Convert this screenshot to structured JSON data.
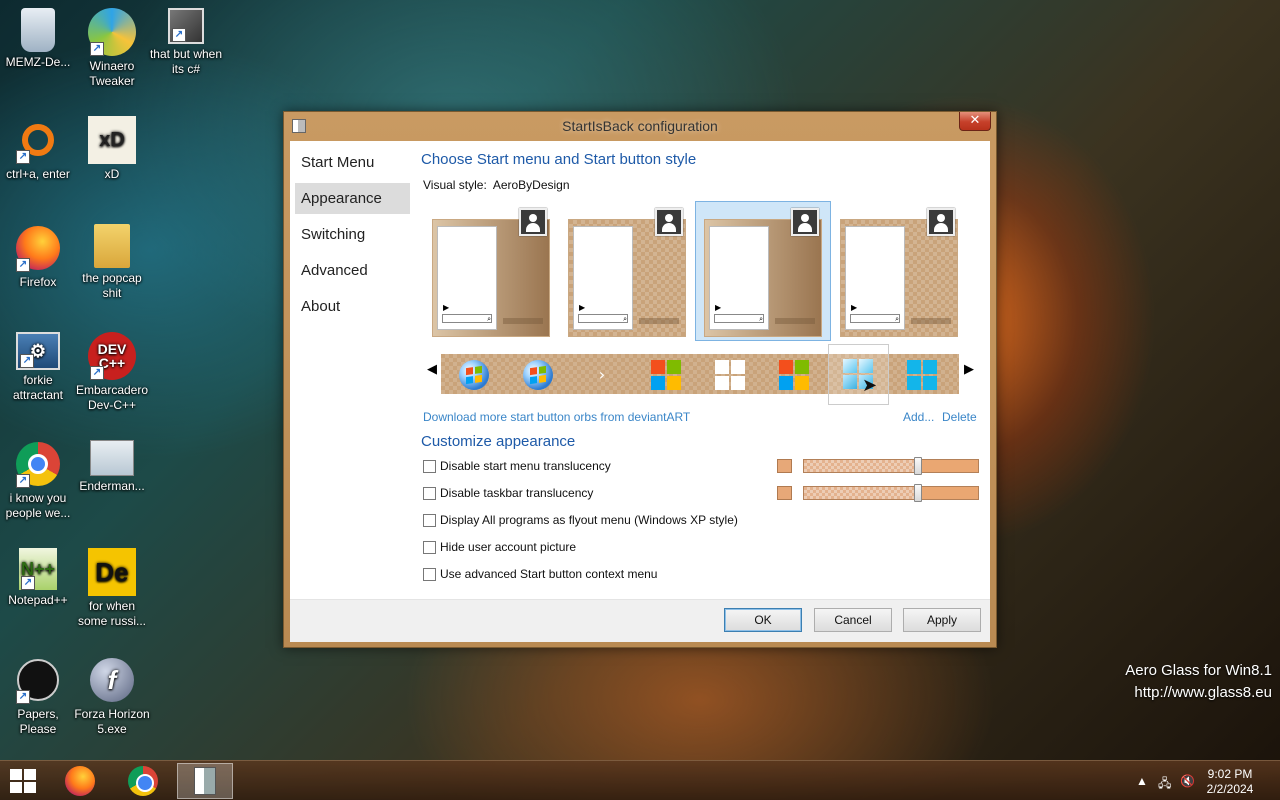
{
  "desktop": {
    "icons": [
      {
        "label": "MEMZ-De..."
      },
      {
        "label": "Winaero Tweaker"
      },
      {
        "label": "that but when its c#"
      },
      {
        "label": "ctrl+a, enter"
      },
      {
        "label": "xD"
      },
      {
        "label": "Firefox"
      },
      {
        "label": "the popcap shit"
      },
      {
        "label": "forkie attractant"
      },
      {
        "label": "Embarcadero Dev-C++"
      },
      {
        "label": "i know you people we..."
      },
      {
        "label": "Enderman..."
      },
      {
        "label": "Notepad++"
      },
      {
        "label": "for when some russi..."
      },
      {
        "label": "Papers, Please"
      },
      {
        "label": "Forza Horizon 5.exe"
      }
    ],
    "watermark_line1": "Aero Glass for Win8.1",
    "watermark_line2": "http://www.glass8.eu"
  },
  "window": {
    "title": "StartIsBack configuration",
    "close_glyph": "✕",
    "nav": [
      {
        "label": "Start Menu"
      },
      {
        "label": "Appearance"
      },
      {
        "label": "Switching"
      },
      {
        "label": "Advanced"
      },
      {
        "label": "About"
      }
    ],
    "selected_nav": "Appearance",
    "heading_style": "Choose Start menu and Start button style",
    "visual_style_label": "Visual style:",
    "visual_style_value": "AeroByDesign",
    "download_link": "Download more start button orbs from deviantART",
    "add_link": "Add...",
    "delete_link": "Delete",
    "heading_customize": "Customize appearance",
    "options": [
      {
        "label": "Disable start menu translucency",
        "checked": false
      },
      {
        "label": "Disable taskbar translucency",
        "checked": false
      },
      {
        "label": "Display All programs as flyout menu (Windows XP style)",
        "checked": false
      },
      {
        "label": "Hide user account picture",
        "checked": false
      },
      {
        "label": "Use advanced Start button context menu",
        "checked": false
      }
    ],
    "translucency_color": "#e7a878",
    "buttons": {
      "ok": "OK",
      "cancel": "Cancel",
      "apply": "Apply"
    }
  },
  "taskbar": {
    "time": "9:02 PM",
    "date": "2/2/2024",
    "tray_up_glyph": "▲"
  }
}
